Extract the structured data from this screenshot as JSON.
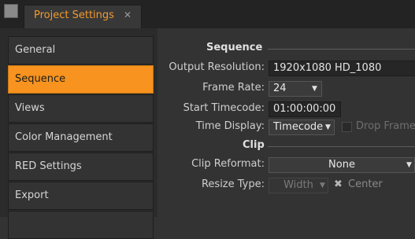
{
  "tab": {
    "title": "Project Settings",
    "close_glyph": "✕"
  },
  "sidebar": {
    "items": [
      {
        "label": "General"
      },
      {
        "label": "Sequence"
      },
      {
        "label": "Views"
      },
      {
        "label": "Color Management"
      },
      {
        "label": "RED Settings"
      },
      {
        "label": "Export"
      }
    ],
    "active_index": 1
  },
  "sequence": {
    "title": "Sequence",
    "output_resolution": {
      "label": "Output Resolution:",
      "value": "1920x1080 HD_1080"
    },
    "frame_rate": {
      "label": "Frame Rate:",
      "value": "24"
    },
    "start_timecode": {
      "label": "Start Timecode:",
      "value": "01:00:00:00"
    },
    "time_display": {
      "label": "Time Display:",
      "value": "Timecode",
      "drop_frame_label": "Drop Frame",
      "drop_frame_checked": false
    }
  },
  "clip": {
    "title": "Clip",
    "clip_reformat": {
      "label": "Clip Reformat:",
      "value": "None"
    },
    "resize_type": {
      "label": "Resize Type:",
      "value": "Width",
      "center_label": "Center",
      "center_checked": true
    }
  },
  "colors": {
    "accent": "#f7931e",
    "tab_text": "#f29a2e"
  }
}
